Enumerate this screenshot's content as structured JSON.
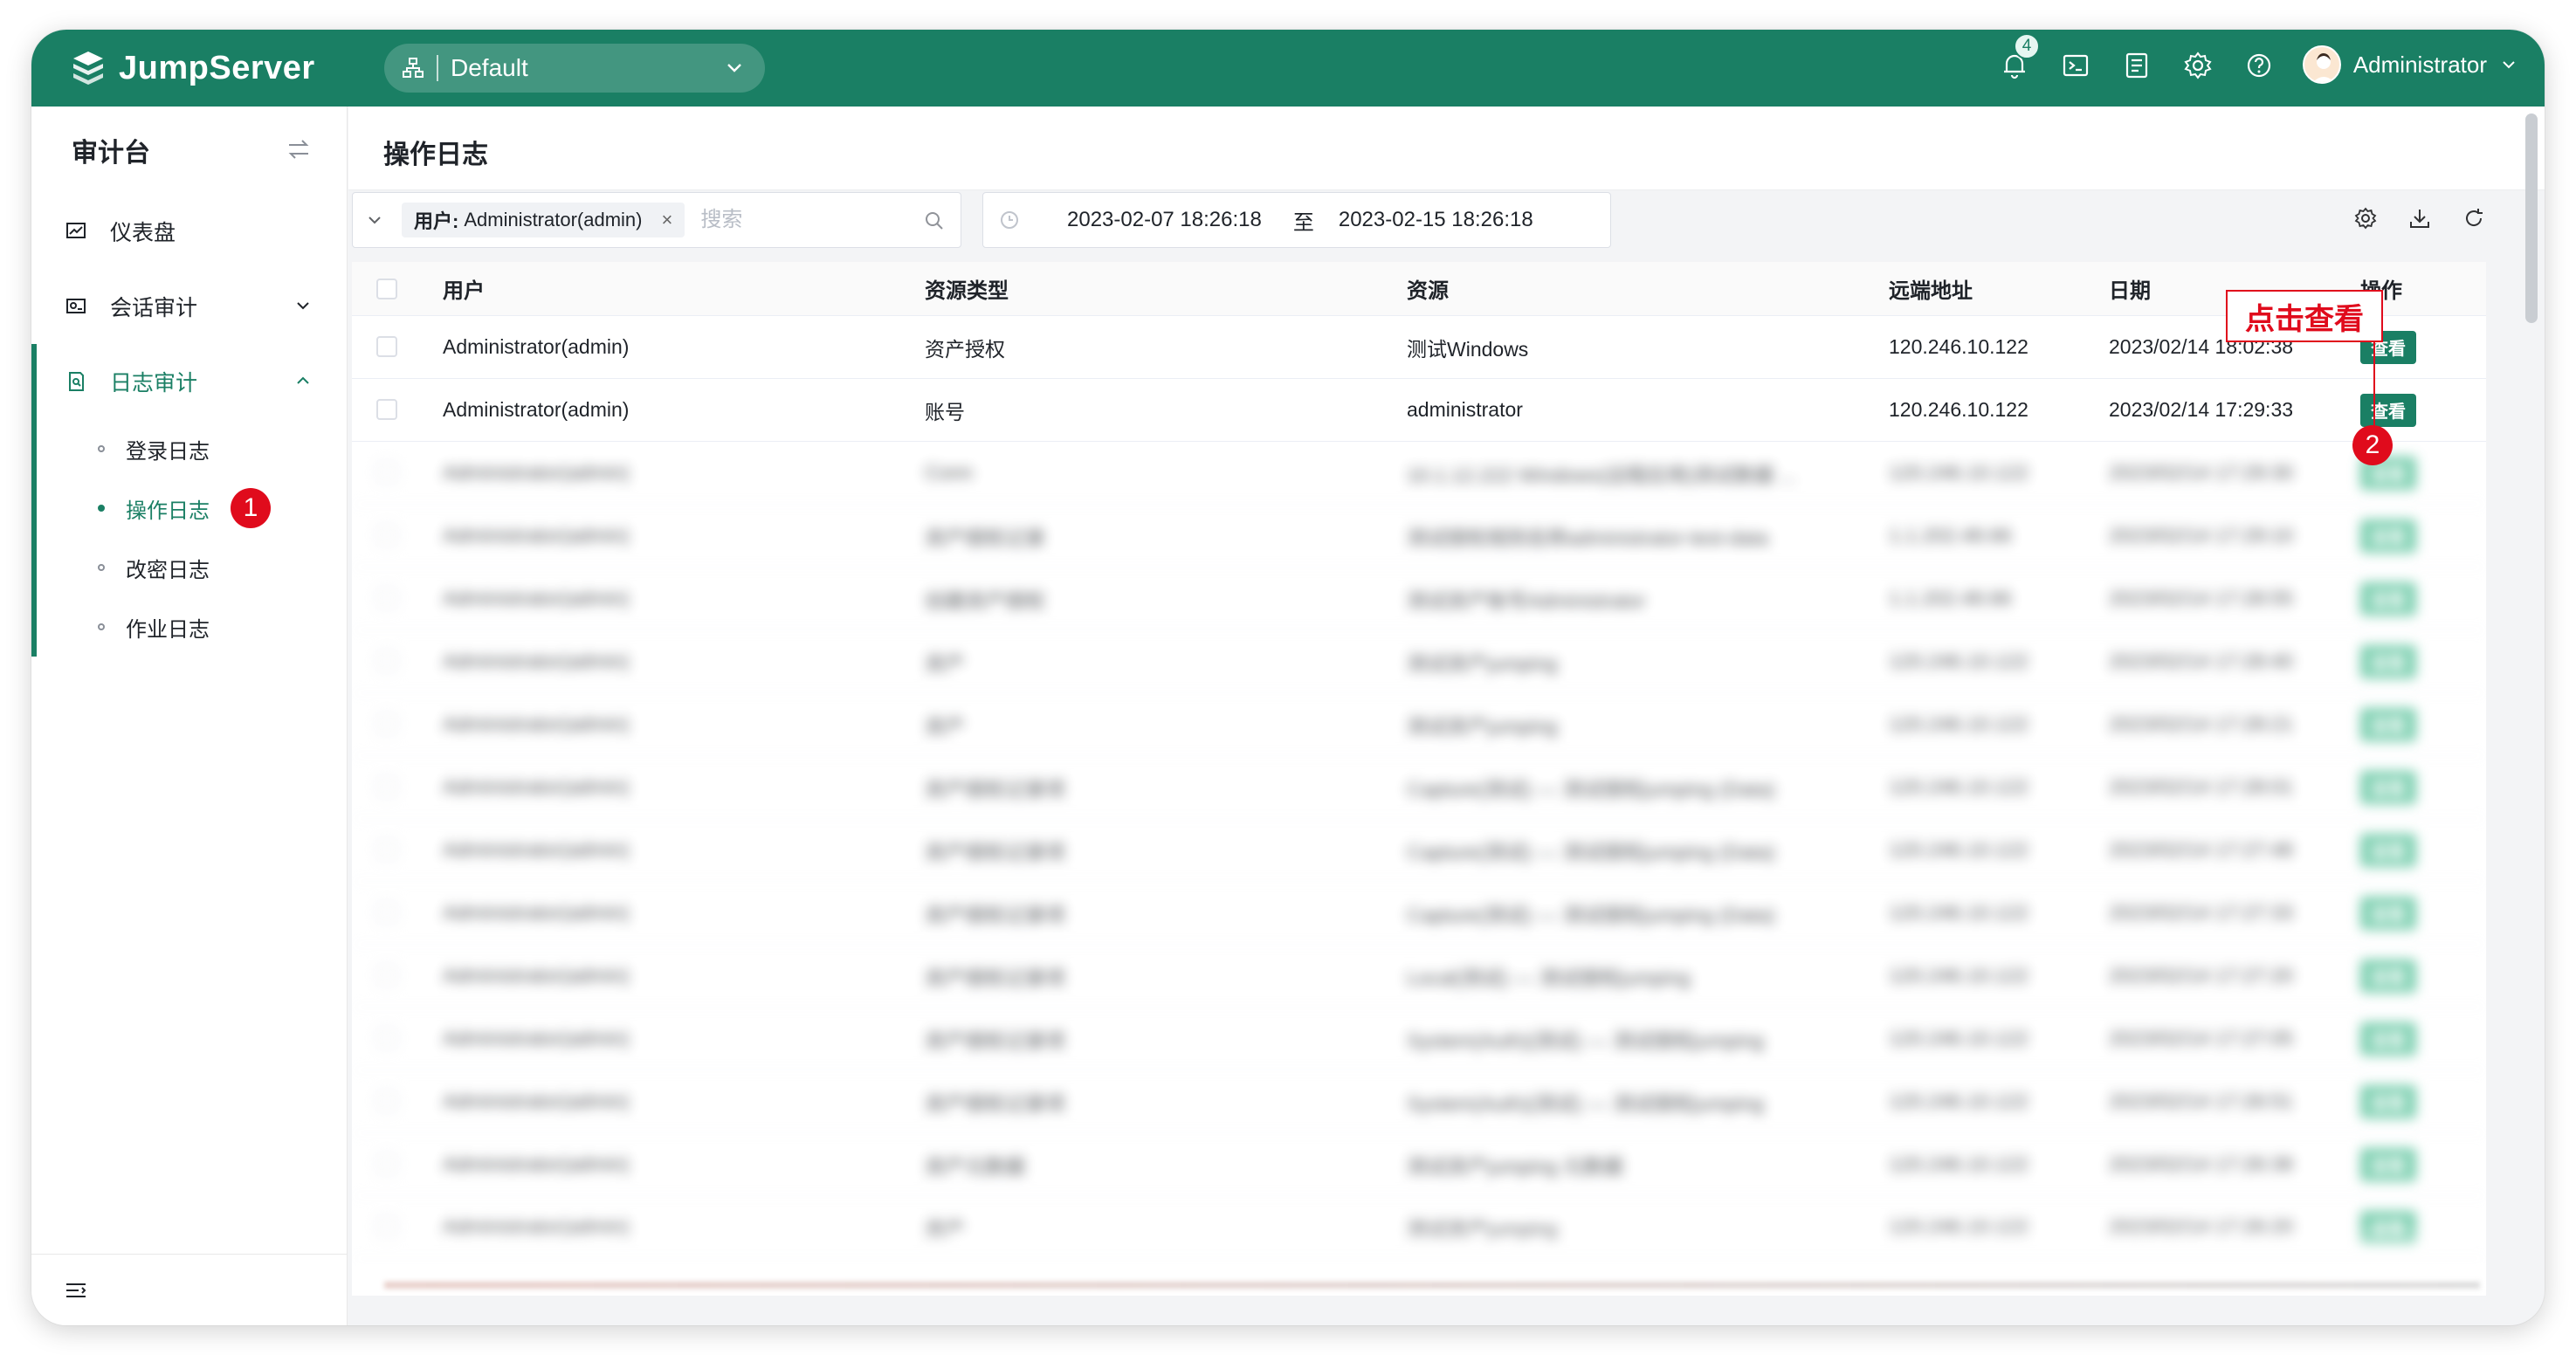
{
  "topbar": {
    "brand": "JumpServer",
    "org": "Default",
    "notification_count": "4",
    "user_name": "Administrator",
    "brand_color": "#1a7f64"
  },
  "sidebar": {
    "title": "审计台",
    "items": [
      {
        "label": "仪表盘",
        "icon": "dashboard-icon"
      },
      {
        "label": "会话审计",
        "icon": "session-audit-icon"
      },
      {
        "label": "日志审计",
        "icon": "log-audit-icon"
      }
    ],
    "sub_items": [
      {
        "label": "登录日志"
      },
      {
        "label": "操作日志"
      },
      {
        "label": "改密日志"
      },
      {
        "label": "作业日志"
      }
    ],
    "marker": "1"
  },
  "main": {
    "page_title": "操作日志",
    "filter_key": "用户:",
    "filter_value": "Administrator(admin)",
    "search_placeholder": "搜索",
    "date_start": "2023-02-07 18:26:18",
    "date_to": "至",
    "date_end": "2023-02-15 18:26:18"
  },
  "table": {
    "headers": {
      "user": "用户",
      "type": "资源类型",
      "resource": "资源",
      "ip": "远端地址",
      "date": "日期",
      "op": "操作"
    },
    "rows": [
      {
        "user": "Administrator(admin)",
        "type": "资产授权",
        "resource": "测试Windows",
        "ip": "120.246.10.122",
        "date": "2023/02/14 18:02:38",
        "op": "查看"
      },
      {
        "user": "Administrator(admin)",
        "type": "账号",
        "resource": "administrator",
        "ip": "120.246.10.122",
        "date": "2023/02/14 17:29:33",
        "op": "查看"
      }
    ],
    "blurred_rows": [
      {
        "user": "Administrator(admin)",
        "type": "Conn",
        "resource": "10.1.12.222 Windows(远程应用)测试数据 ...",
        "ip": "120.246.10.122",
        "date": "2023/02/14 17:29:30",
        "op": "查看"
      },
      {
        "user": "Administrator(admin)",
        "type": "资产授权记录",
        "resource": "测试授权规则名称administrator-test-data",
        "ip": "1.1.202.48.66",
        "date": "2023/02/14 17:29:10",
        "op": "查看"
      },
      {
        "user": "Administrator(admin)",
        "type": "创建资产授权",
        "resource": "测试资产账号Administrator",
        "ip": "1.1.202.48.66",
        "date": "2023/02/14 17:28:55",
        "op": "查看"
      },
      {
        "user": "Administrator(admin)",
        "type": "资产",
        "resource": "测试资产jumping",
        "ip": "120.246.10.122",
        "date": "2023/02/14 17:28:40",
        "op": "查看"
      },
      {
        "user": "Administrator(admin)",
        "type": "资产",
        "resource": "测试资产jumping",
        "ip": "120.246.10.122",
        "date": "2023/02/14 17:28:21",
        "op": "查看"
      },
      {
        "user": "Administrator(admin)",
        "type": "资产授权记录项",
        "resource": "Capture(测试) — 测试授权jumping (Data)",
        "ip": "120.246.10.122",
        "date": "2023/02/14 17:28:01",
        "op": "查看"
      },
      {
        "user": "Administrator(admin)",
        "type": "资产授权记录项",
        "resource": "Capture(测试) — 测试授权jumping (Data)",
        "ip": "120.246.10.122",
        "date": "2023/02/14 17:27:48",
        "op": "查看"
      },
      {
        "user": "Administrator(admin)",
        "type": "资产授权记录项",
        "resource": "Capture(测试) — 测试授权jumping (Data)",
        "ip": "120.246.10.122",
        "date": "2023/02/14 17:27:33",
        "op": "查看"
      },
      {
        "user": "Administrator(admin)",
        "type": "资产授权记录项",
        "resource": "Local(测试) — 测试授权jumping",
        "ip": "120.246.10.122",
        "date": "2023/02/14 17:27:20",
        "op": "查看"
      },
      {
        "user": "Administrator(admin)",
        "type": "资产授权记录项",
        "resource": "System(Auth)(测试) — 测试授权jumping",
        "ip": "120.246.10.122",
        "date": "2023/02/14 17:27:05",
        "op": "查看"
      },
      {
        "user": "Administrator(admin)",
        "type": "资产授权记录项",
        "resource": "System(Auth)(测试) — 测试授权jumping",
        "ip": "120.246.10.122",
        "date": "2023/02/14 17:26:51",
        "op": "查看"
      },
      {
        "user": "Administrator(admin)",
        "type": "资产元数据",
        "resource": "测试资产jumping 元数据",
        "ip": "120.246.10.122",
        "date": "2023/02/14 17:26:38",
        "op": "查看"
      },
      {
        "user": "Administrator(admin)",
        "type": "资产",
        "resource": "测试资产jumping",
        "ip": "120.246.10.122",
        "date": "2023/02/14 17:26:20",
        "op": "查看"
      }
    ]
  },
  "annotation": {
    "callout": "点击查看",
    "marker": "2",
    "color": "#e00b1c"
  }
}
